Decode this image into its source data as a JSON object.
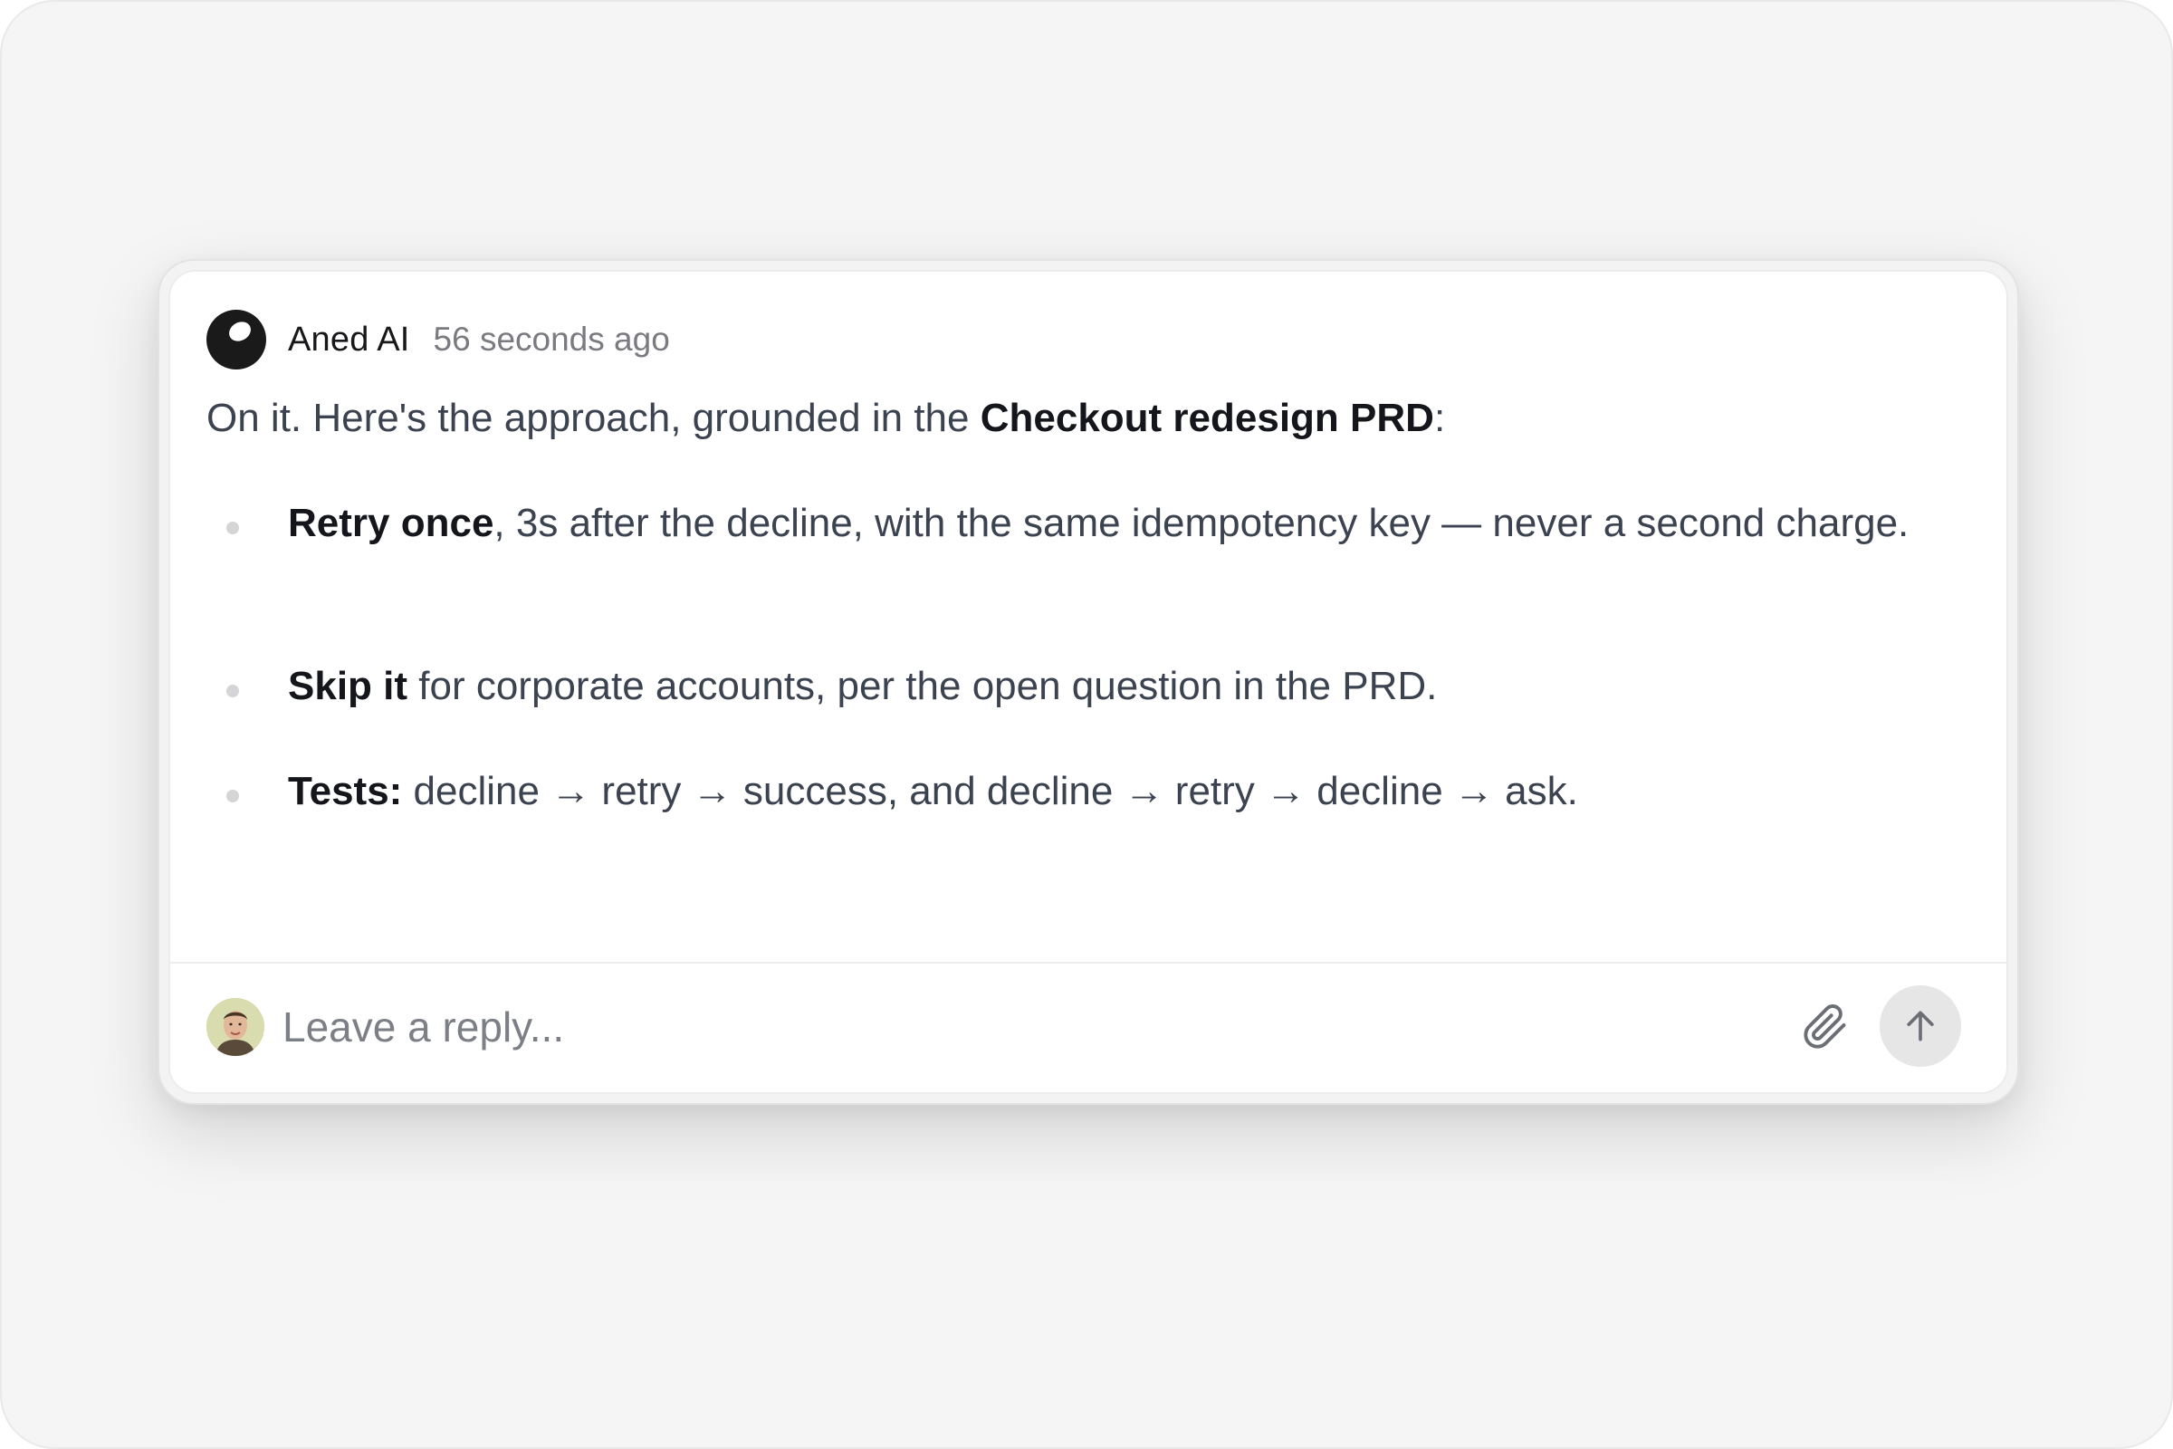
{
  "message": {
    "author": "Aned AI",
    "timestamp": "56 seconds ago",
    "intro_text": "On it. Here's the approach, grounded in the ",
    "intro_bold": "Checkout redesign PRD",
    "intro_end": ":",
    "bullets": [
      {
        "bold": "Retry once",
        "text": ", 3s after the decline, with the same idempotency key — never a second charge."
      },
      {
        "bold": "Skip it",
        "text": " for corporate accounts, per the open question in the PRD."
      },
      {
        "bold": "Tests:",
        "text": " decline → retry → success, and decline → retry → decline → ask."
      }
    ]
  },
  "reply": {
    "placeholder": "Leave a reply..."
  },
  "icons": {
    "bot_avatar": "aned-ai-logo-icon",
    "user_avatar": "user-avatar",
    "attach": "paperclip-icon",
    "send": "arrow-up-icon"
  },
  "colors": {
    "background": "#f5f5f5",
    "card": "#ffffff",
    "text": "#3c4350",
    "bold_text": "#14161c",
    "muted": "#7a7a80",
    "send_button": "#e6e6e6"
  }
}
